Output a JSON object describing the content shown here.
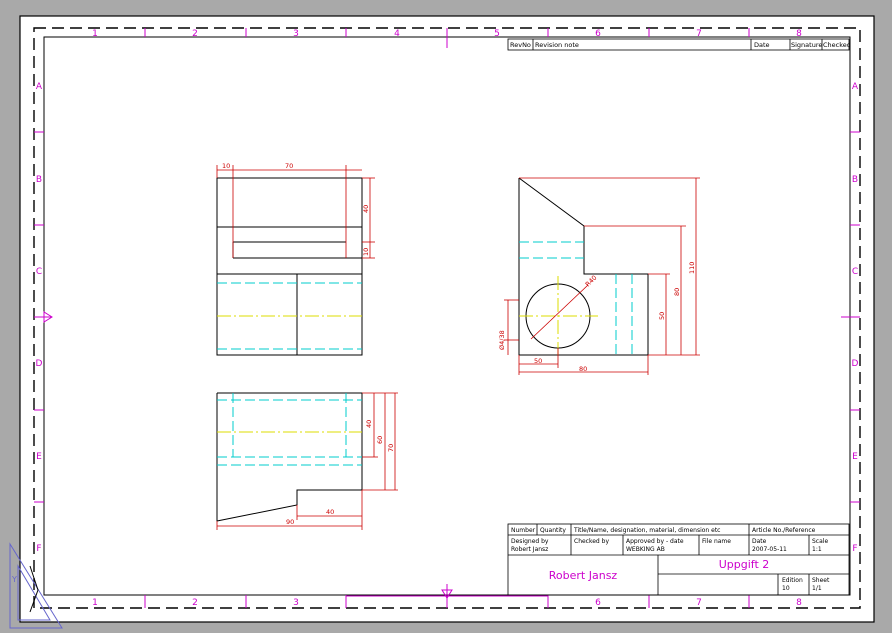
{
  "colors": {
    "background": "#a9a9a9",
    "paper": "#ffffff",
    "outline": "#000000",
    "dimension": "#cc0000",
    "hidden": "#00cccc",
    "center": "#dddd00",
    "grid_label": "#cc00cc",
    "title_name": "#cc00cc"
  },
  "grid": {
    "columns": [
      "1",
      "2",
      "3",
      "4",
      "5",
      "6",
      "7",
      "8"
    ],
    "rows": [
      "A",
      "B",
      "C",
      "D",
      "E",
      "F"
    ]
  },
  "revision_table": {
    "rev_no": "RevNo",
    "revision_note": "Revision note",
    "date": "Date",
    "signature": "Signature",
    "checked": "Checked"
  },
  "title_block": {
    "number_label": "Number",
    "quantity_label": "Quantity",
    "title_label": "Title/Name, designation, material, dimension etc",
    "article_label": "Article No./Reference",
    "designed_by_label": "Designed by",
    "designed_by_value": "Robert Jansz",
    "checked_by_label": "Checked by",
    "approved_by_label": "Approved by - date",
    "approved_by_value": "WEBKING AB",
    "file_name_label": "File name",
    "date_label": "Date",
    "date_value": "2007-05-11",
    "scale_label": "Scale",
    "scale_value": "1:1",
    "author_name": "Robert Jansz",
    "drawing_title": "Uppgift 2",
    "edition_label": "Edition",
    "edition_value": "10",
    "sheet_label": "Sheet",
    "sheet_value": "1/1"
  },
  "dimensions": {
    "front": {
      "d10": "10",
      "d70": "70",
      "d40": "40",
      "d10b": "10"
    },
    "top": {
      "d40": "40",
      "d60": "60",
      "d70": "70",
      "d90": "90",
      "d40b": "40"
    },
    "side": {
      "d110": "110",
      "d80": "80",
      "d50": "50",
      "d_r40": "R40",
      "d_phi": "Ø4/38",
      "d50w": "50",
      "d80w": "80"
    }
  }
}
